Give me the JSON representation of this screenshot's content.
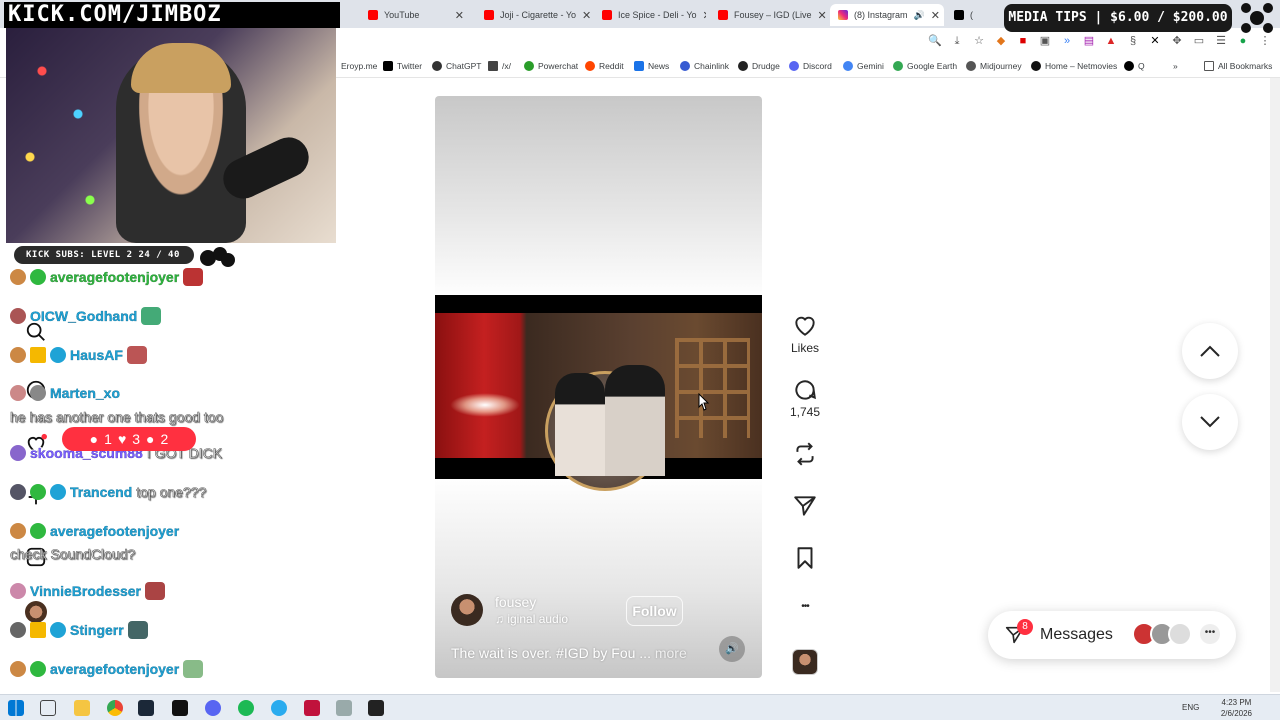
{
  "overlay": {
    "logo_text": "KICK.COM/JIMBOZ",
    "kick_subs": "KICK SUBS: LEVEL 2 24 / 40",
    "media_tips": "MEDIA TIPS | $6.00 / $200.00"
  },
  "browser": {
    "tabs": [
      {
        "label": "YouTube",
        "close": "✕",
        "favicon_color": "#ff0000",
        "active": false
      },
      {
        "label": "Joji - Cigarette - Yo",
        "close": "✕",
        "favicon_color": "#ff0000",
        "active": false
      },
      {
        "label": "Ice Spice - Deli - Yo",
        "close": "✕",
        "favicon_color": "#ff0000",
        "active": false
      },
      {
        "label": "Fousey – IGD (Live",
        "close": "✕",
        "favicon_color": "#ff0000",
        "active": false
      },
      {
        "label": "(8) Instagram",
        "close": "✕",
        "favicon_color": "#d6249f",
        "active": true
      },
      {
        "label": "(",
        "close": "",
        "favicon_color": "#000000",
        "active": false
      }
    ],
    "bookmarks": [
      {
        "label": "Eroyp.me"
      },
      {
        "label": "Twitter"
      },
      {
        "label": "ChatGPT"
      },
      {
        "label": "/x/"
      },
      {
        "label": "Powerchat"
      },
      {
        "label": "Reddit"
      },
      {
        "label": "News"
      },
      {
        "label": "Chainlink"
      },
      {
        "label": "Drudge"
      },
      {
        "label": "Discord"
      },
      {
        "label": "Gemini"
      },
      {
        "label": "Google Earth"
      },
      {
        "label": "Midjourney"
      },
      {
        "label": "Home – Netmovies"
      },
      {
        "label": "Q"
      }
    ],
    "bookmarks_more": "»",
    "all_bookmarks": "All Bookmarks"
  },
  "chat": {
    "lines": [
      {
        "user": "averagefootenjoyer",
        "msg": "",
        "color": "green"
      },
      {
        "user": "OICW_Godhand",
        "msg": "",
        "color": "blue"
      },
      {
        "user": "HausAF",
        "msg": "",
        "color": "blue"
      },
      {
        "user": "Marten_xo",
        "msg": "",
        "color": "blue"
      },
      {
        "user": "",
        "msg": "he has another one thats good too",
        "color": ""
      },
      {
        "user": "skooma_scum88",
        "msg": "I GOT DICK",
        "color": "purple"
      },
      {
        "user": "Trancend",
        "msg": "top one???",
        "color": "blue"
      },
      {
        "user": "averagefootenjoyer",
        "msg": "",
        "color": "blue"
      },
      {
        "user": "",
        "msg": "check SoundCloud?",
        "color": ""
      },
      {
        "user": "VinnieBrodesser",
        "msg": "",
        "color": "blue"
      },
      {
        "user": "Stingerr",
        "msg": "",
        "color": "blue"
      },
      {
        "user": "averagefootenjoyer",
        "msg": "",
        "color": "blue"
      }
    ],
    "notif": {
      "comments": "1",
      "likes": "3",
      "follows": "2"
    }
  },
  "reel": {
    "author": "fousey",
    "audio": "iginal audio",
    "follow_label": "Follow",
    "caption": "The wait is over. #IGD by Fou ...",
    "more_label": "more",
    "mute_icon": "🔊"
  },
  "actions": {
    "likes_label": "Likes",
    "comments_count": "1,745",
    "more_icon": "•••"
  },
  "messages": {
    "label": "Messages",
    "badge": "8",
    "more_icon": "•••"
  },
  "taskbar": {
    "lang": "ENG",
    "time": "4:23 PM",
    "date": "2/6/2026"
  }
}
